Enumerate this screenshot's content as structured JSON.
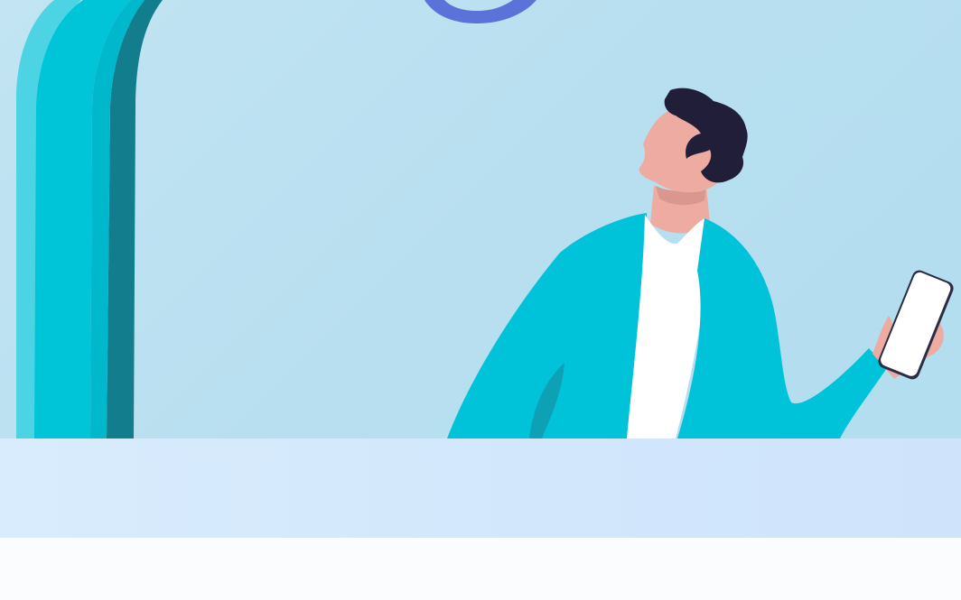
{
  "hero": {
    "illustration": "man-looking-up-holding-phone-illustration",
    "colors": {
      "sky": "#b8dff0",
      "arch_light": "#4dd4e4",
      "arch_mid": "#00c4d8",
      "arch_dark": "#127d8d",
      "ring": "#5b73d8",
      "jacket": "#00c3d9",
      "jacket_shadow": "#0ea0b5",
      "shirt": "#ffffff",
      "skin": "#eeaba2",
      "hair": "#211e3a",
      "phone_body": "#2a2d44",
      "phone_screen": "#ffffff"
    }
  },
  "band": {
    "color": "#d6eafd"
  },
  "footer": {
    "color": "#fbfcfe"
  }
}
